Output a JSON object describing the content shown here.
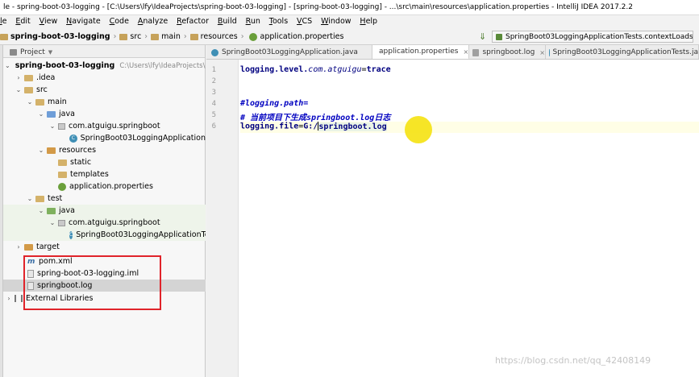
{
  "window": {
    "title": "le - spring-boot-03-logging - [C:\\Users\\lfy\\IdeaProjects\\spring-boot-03-logging] - [spring-boot-03-logging] - ...\\src\\main\\resources\\application.properties - IntelliJ IDEA 2017.2.2"
  },
  "menu": [
    "le",
    "Edit",
    "View",
    "Navigate",
    "Code",
    "Analyze",
    "Refactor",
    "Build",
    "Run",
    "Tools",
    "VCS",
    "Window",
    "Help"
  ],
  "breadcrumb": [
    "spring-boot-03-logging",
    "src",
    "main",
    "resources",
    "application.properties"
  ],
  "run_config": "SpringBoot03LoggingApplicationTests.contextLoads",
  "project_panel": {
    "header": "Project",
    "tree": [
      {
        "label": "spring-boot-03-logging",
        "hint": "C:\\Users\\lfy\\IdeaProjects\\s"
      },
      {
        "label": ".idea"
      },
      {
        "label": "src"
      },
      {
        "label": "main"
      },
      {
        "label": "java"
      },
      {
        "label": "com.atguigu.springboot"
      },
      {
        "label": "SpringBoot03LoggingApplication"
      },
      {
        "label": "resources"
      },
      {
        "label": "static"
      },
      {
        "label": "templates"
      },
      {
        "label": "application.properties"
      },
      {
        "label": "test"
      },
      {
        "label": "java"
      },
      {
        "label": "com.atguigu.springboot"
      },
      {
        "label": "SpringBoot03LoggingApplicationTe"
      },
      {
        "label": "target"
      },
      {
        "label": "pom.xml"
      },
      {
        "label": "spring-boot-03-logging.iml"
      },
      {
        "label": "springboot.log"
      },
      {
        "label": "External Libraries"
      }
    ]
  },
  "tabs": [
    {
      "label": "SpringBoot03LoggingApplication.java"
    },
    {
      "label": "application.properties",
      "close": "×"
    },
    {
      "label": "springboot.log",
      "close": "×"
    },
    {
      "label": "SpringBoot03LoggingApplicationTests.ja"
    }
  ],
  "editor": {
    "line_numbers": [
      "1",
      "2",
      "3",
      "4",
      "5",
      "6"
    ],
    "lines": [
      {
        "key": "logging.level.",
        "key_italic": "com.atguigu",
        "eq": "=",
        "value": "trace"
      },
      {
        "text": ""
      },
      {
        "text": ""
      },
      {
        "comment": "#logging.path="
      },
      {
        "comment": "# 当前项目下生成springboot.log日志"
      },
      {
        "key": "logging.file",
        "eq": "=",
        "value_pre": "G:/",
        "value_post": "springboot.log"
      }
    ]
  },
  "watermark": "https://blog.csdn.net/qq_42408149",
  "colors": {
    "highlight_box": "#e0232a",
    "cursor_dot": "#f5e316"
  }
}
